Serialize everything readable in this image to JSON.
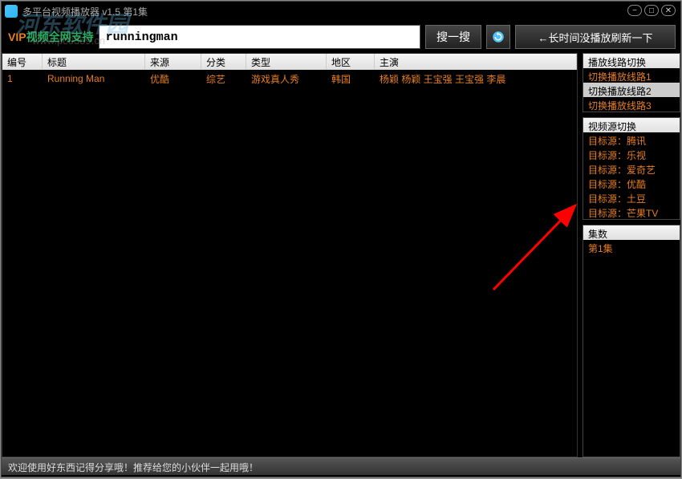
{
  "window": {
    "title": "多平台视频播放器 v1.5 第1集"
  },
  "watermark": {
    "main": "河东软件园",
    "sub": "www.pc0359.cn"
  },
  "search": {
    "vip_label_1": "VIP",
    "vip_label_2": "视频全网支持",
    "input_value": "runningman",
    "search_btn": "搜一搜",
    "refresh_btn": "←长时间没播放刷新一下"
  },
  "table": {
    "headers": {
      "col1": "编号",
      "col2": "标题",
      "col3": "来源",
      "col4": "分类",
      "col5": "类型",
      "col6": "地区",
      "col7": "主演"
    },
    "rows": [
      {
        "num": "1",
        "title": "Running Man",
        "source": "优酷",
        "category": "综艺",
        "type": "游戏真人秀",
        "region": "韩国",
        "cast": "杨颖 杨颖 王宝强 王宝强 李晨"
      }
    ]
  },
  "panels": {
    "route": {
      "title": "播放线路切换",
      "items": [
        "切换播放线路1",
        "切换播放线路2",
        "切换播放线路3"
      ],
      "selected": 1
    },
    "source": {
      "title": "视频源切换",
      "items": [
        "目标源：腾讯",
        "目标源：乐视",
        "目标源：爱奇艺",
        "目标源：优酷",
        "目标源：土豆",
        "目标源：芒果TV"
      ]
    },
    "episodes": {
      "title": "集数",
      "items": [
        "第1集"
      ]
    }
  },
  "status": "欢迎使用好东西记得分享哦！推荐给您的小伙伴一起用哦！"
}
